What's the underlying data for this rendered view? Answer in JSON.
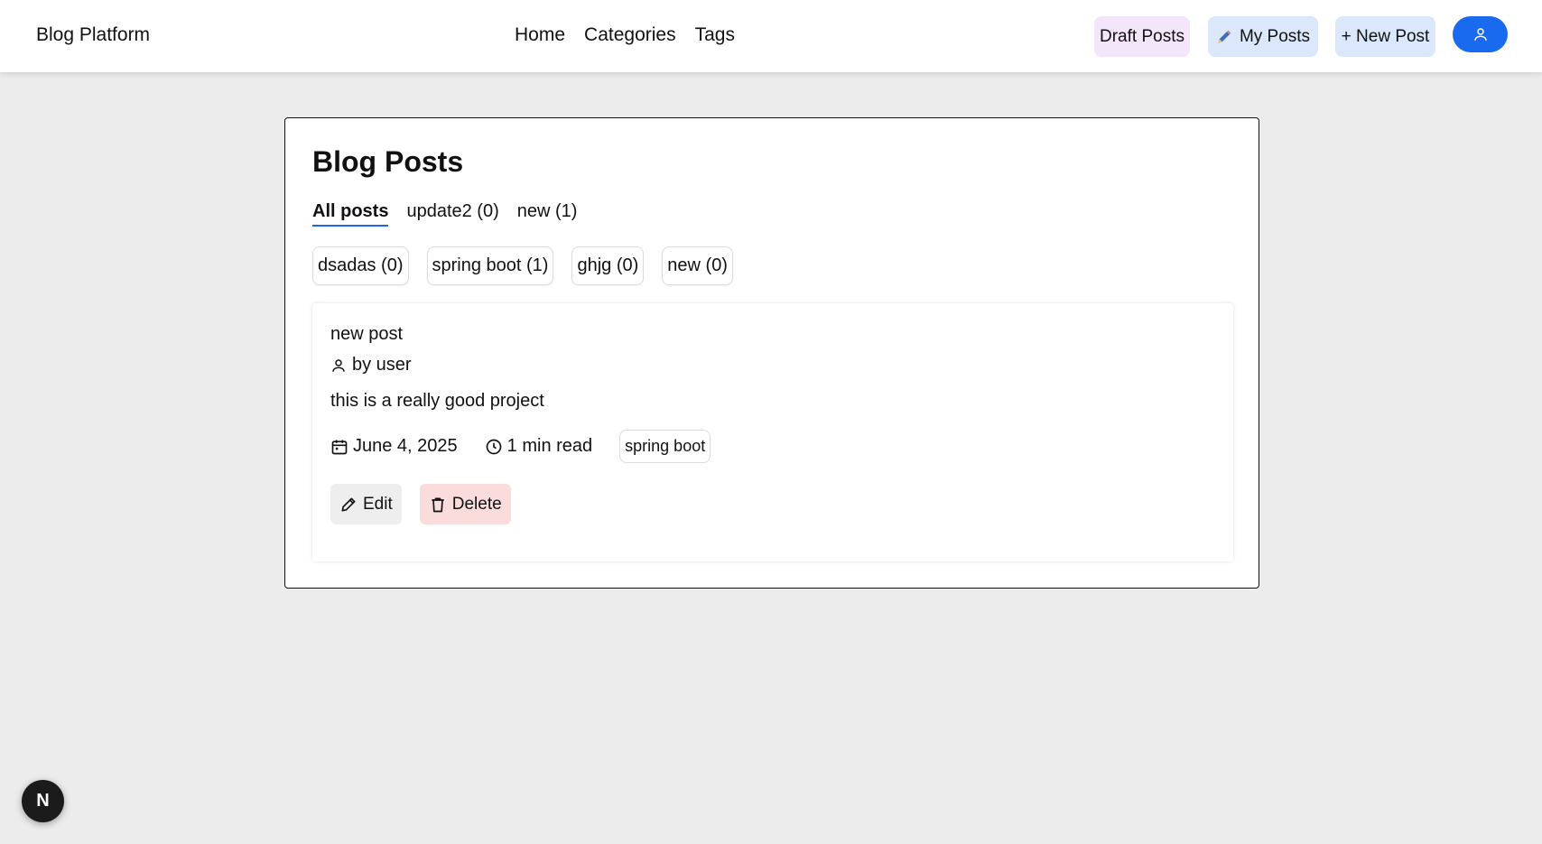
{
  "header": {
    "brand": "Blog Platform",
    "nav": [
      "Home",
      "Categories",
      "Tags"
    ],
    "draft_posts": "Draft Posts",
    "my_posts": "My Posts",
    "new_post": "+ New Post",
    "user_icon": "user-icon"
  },
  "main": {
    "title": "Blog Posts",
    "tabs": [
      {
        "label": "All posts",
        "active": true
      },
      {
        "label": "update2 (0)"
      },
      {
        "label": "new (1)"
      }
    ],
    "tags": [
      "dsadas (0)",
      "spring boot (1)",
      "ghjg (0)",
      "new (0)"
    ],
    "post": {
      "title": "new post",
      "author": "by user",
      "excerpt": "this is a really good project",
      "date": "June 4, 2025",
      "read_time": "1 min read",
      "tag": "spring boot",
      "edit_label": "Edit",
      "delete_label": "Delete"
    }
  },
  "badge": "N",
  "colors": {
    "accent": "#1a6af0",
    "draft_bg": "#f3e6fb",
    "myposts_bg": "#dbe8fb",
    "delete_bg": "#fbdcdc"
  }
}
